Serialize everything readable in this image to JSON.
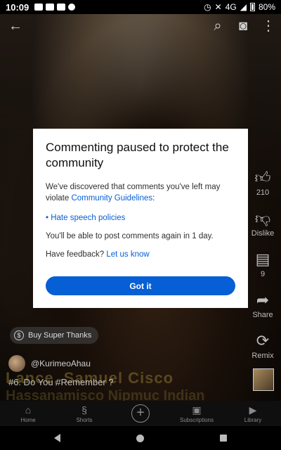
{
  "status_bar": {
    "time": "10:09",
    "network": "4G",
    "battery": "80%"
  },
  "top_bar": {
    "back_icon": "arrow-left-icon",
    "search_icon": "search-icon",
    "camera_icon": "camera-icon",
    "more_icon": "more-vert-icon"
  },
  "side_actions": [
    {
      "name": "like",
      "icon": "thumbs-up-icon",
      "label": "210"
    },
    {
      "name": "dislike",
      "icon": "thumbs-down-icon",
      "label": "Dislike"
    },
    {
      "name": "comments",
      "icon": "comment-icon",
      "label": "9"
    },
    {
      "name": "share",
      "icon": "share-icon",
      "label": "Share"
    },
    {
      "name": "remix",
      "icon": "remix-icon",
      "label": "Remix"
    }
  ],
  "video": {
    "super_thanks_label": "Buy Super Thanks",
    "channel_name": "@KurimeoAhau",
    "caption_prefix": "#6: Do You ",
    "caption_hashtag": "#Remember",
    "caption_suffix": " ?",
    "overlay_line1": "Lance, Samuel Cisco",
    "overlay_line2": "Hassanamisco Nipmuc Indian"
  },
  "dialog": {
    "title": "Commenting paused to protect the community",
    "body_text": "We've discovered that comments you've left may violate ",
    "body_link": "Community Guidelines",
    "body_end": ":",
    "bullet": "• Hate speech policies",
    "duration_text": "You'll be able to post comments again in 1 day.",
    "feedback_text": "Have feedback? ",
    "feedback_link": "Let us know",
    "button_label": "Got it"
  },
  "bottom_nav": [
    {
      "label": "Home",
      "icon": "home-icon"
    },
    {
      "label": "Shorts",
      "icon": "shorts-icon"
    },
    {
      "label": "",
      "icon": "add-icon"
    },
    {
      "label": "Subscriptions",
      "icon": "subscriptions-icon"
    },
    {
      "label": "Library",
      "icon": "library-icon"
    }
  ],
  "colors": {
    "accent": "#065fd4",
    "dialog_bg": "#ffffff"
  }
}
